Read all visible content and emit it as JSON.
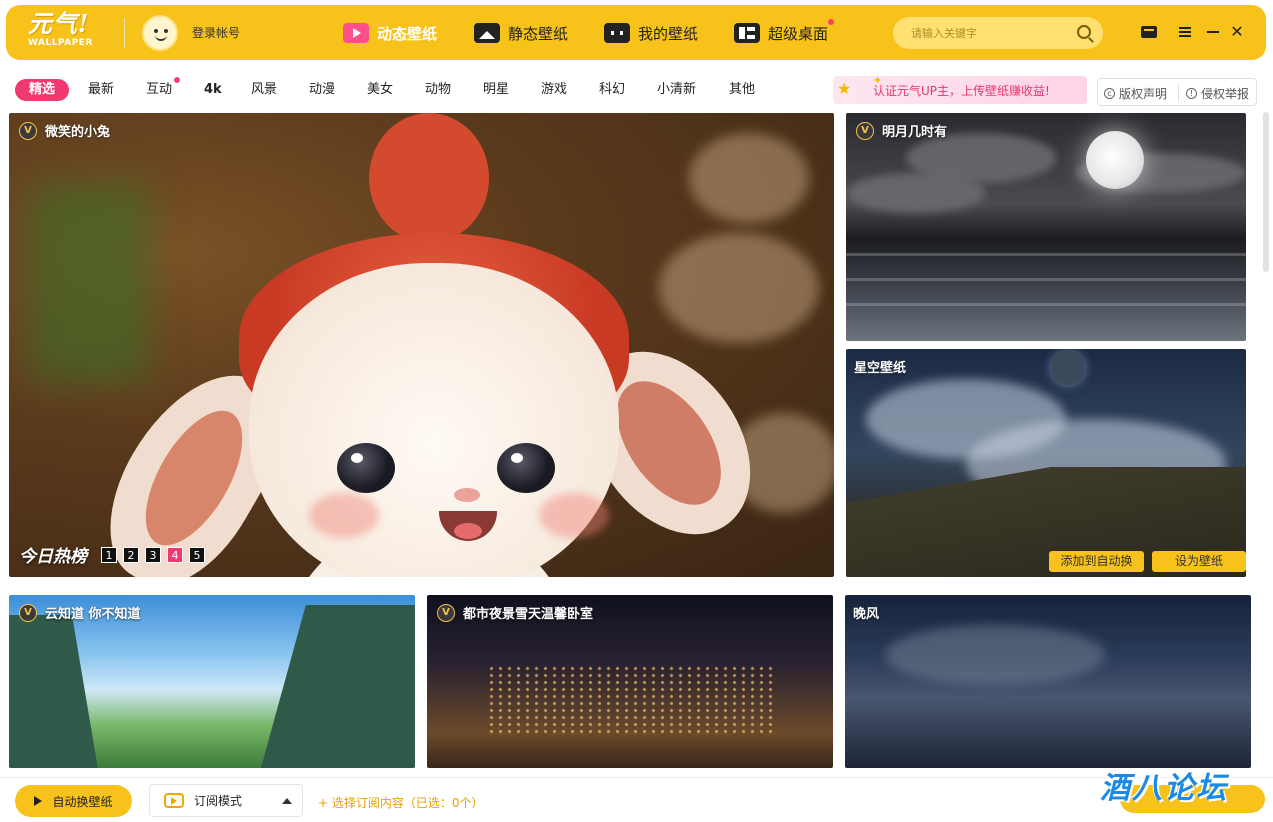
{
  "app": {
    "logo_text": "元气!",
    "logo_sub": "WALLPAPER",
    "login_label": "登录帐号"
  },
  "nav": {
    "items": [
      {
        "label": "动态壁纸",
        "icon": "video-play-icon",
        "active": true
      },
      {
        "label": "静态壁纸",
        "icon": "image-icon",
        "active": false
      },
      {
        "label": "我的壁纸",
        "icon": "my-wallpaper-icon",
        "active": false
      },
      {
        "label": "超级桌面",
        "icon": "desktop-icon",
        "active": false,
        "dot": true
      }
    ]
  },
  "search": {
    "placeholder": "请输入关键字"
  },
  "window_controls": [
    "mail-icon",
    "menu-icon",
    "minimize-icon",
    "close-icon"
  ],
  "categories": [
    "精选",
    "最新",
    "互动",
    "4k",
    "风景",
    "动漫",
    "美女",
    "动物",
    "明星",
    "游戏",
    "科幻",
    "小清新",
    "其他"
  ],
  "category_active": "精选",
  "promo": {
    "text": "认证元气UP主，上传壁纸赚收益!"
  },
  "header_buttons": {
    "copyright": "版权声明",
    "report": "侵权举报"
  },
  "tiles": {
    "featured": {
      "title": "微笑的小兔",
      "badge": "V"
    },
    "hot": {
      "label": "今日热榜",
      "pages": [
        "1",
        "2",
        "3",
        "4",
        "5"
      ],
      "current_page": "4"
    },
    "moon": {
      "title": "明月几时有",
      "badge": "V"
    },
    "starry": {
      "title": "星空壁纸",
      "add_auto": "添加到自动换",
      "set_wallpaper": "设为壁纸"
    },
    "clouds": {
      "title": "云知道 你不知道",
      "badge": "V"
    },
    "city": {
      "title": "都市夜景雪天温馨卧室",
      "badge": "V"
    },
    "evening": {
      "title": "晚风"
    }
  },
  "bottom": {
    "auto_switch": "自动换壁纸",
    "subscribe_mode": "订阅模式",
    "pick_content": "+ 选择订阅内容（已选：0个）"
  },
  "watermark": {
    "text": "酒八论坛"
  },
  "colors": {
    "brand_yellow": "#f7c21a",
    "accent_pink": "#f0396e"
  }
}
